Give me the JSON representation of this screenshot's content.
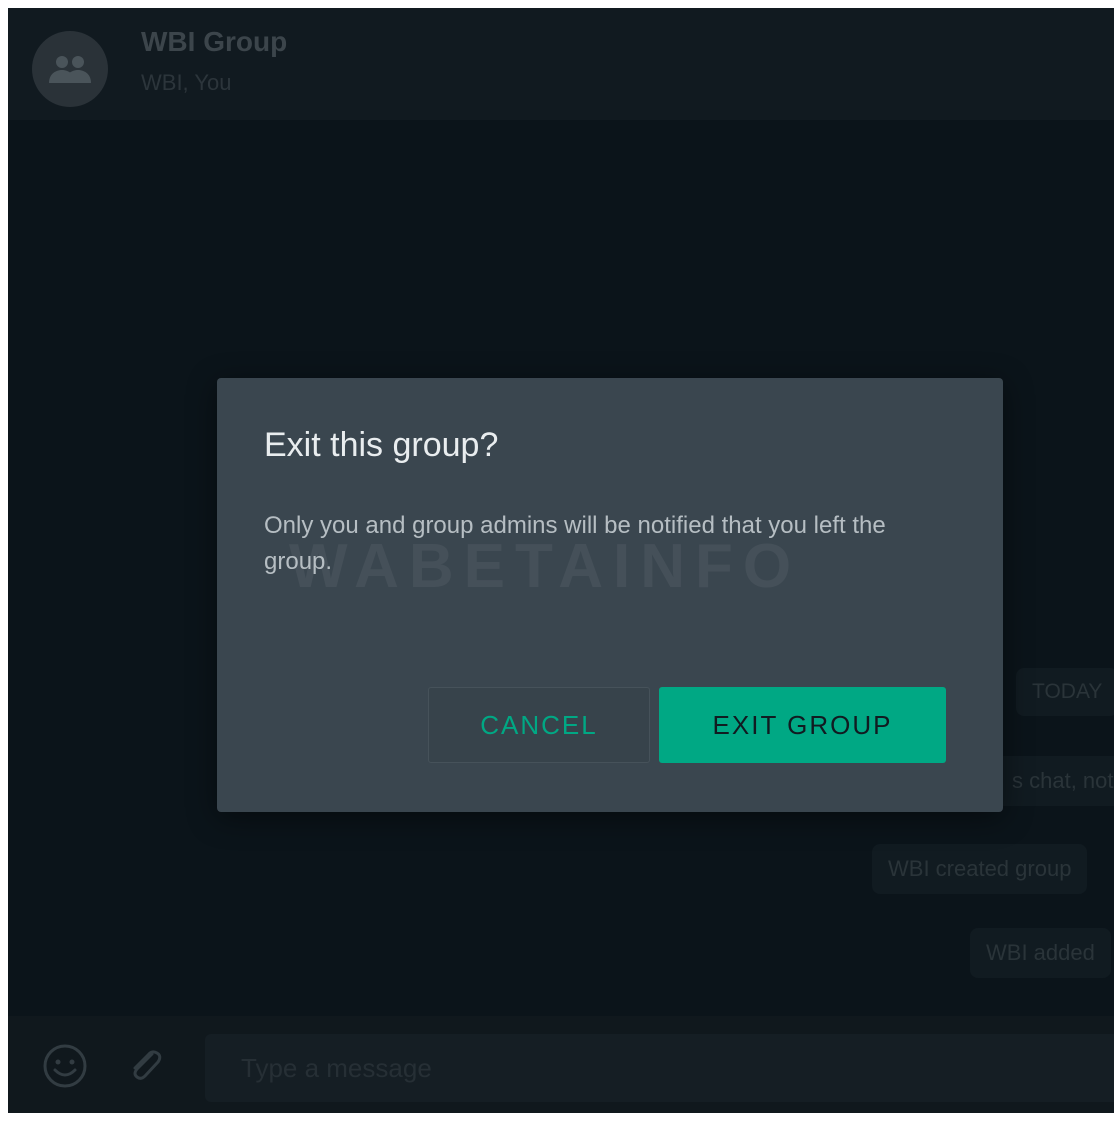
{
  "header": {
    "title": "WBI Group",
    "subtitle": "WBI, You"
  },
  "chat": {
    "date_chip": "TODAY",
    "system_messages": [
      "s chat, not",
      "WBI created group",
      "WBI added"
    ]
  },
  "footer": {
    "placeholder": "Type a message"
  },
  "dialog": {
    "title": "Exit this group?",
    "body": "Only you and group admins will be notified that you left the group.",
    "watermark": "WABETAINFO",
    "cancel_label": "CANCEL",
    "confirm_label": "EXIT GROUP"
  },
  "colors": {
    "accent": "#00a884",
    "dialog_bg": "#3a464f",
    "app_bg": "#0b141a"
  }
}
